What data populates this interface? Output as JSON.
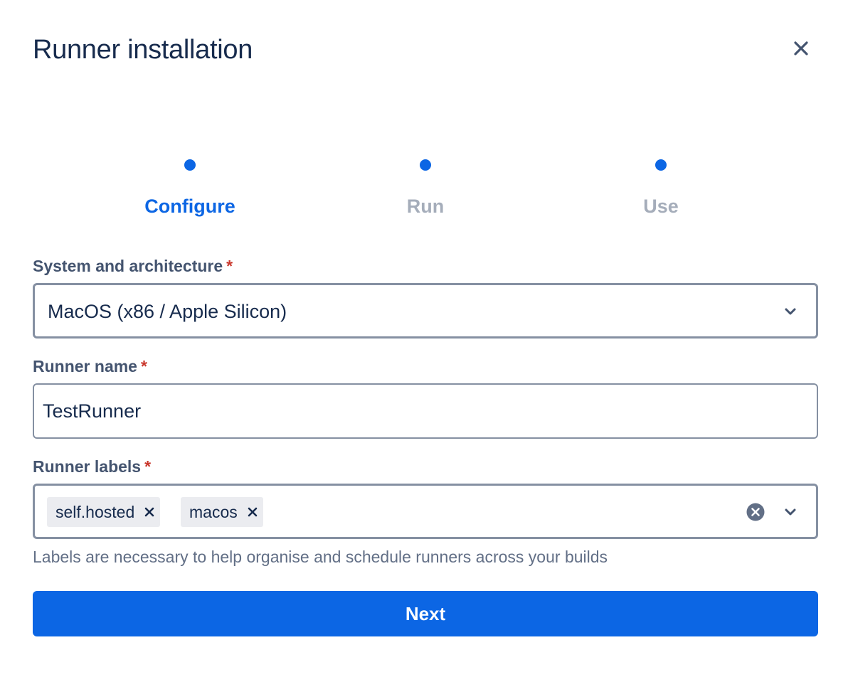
{
  "dialog": {
    "title": "Runner installation",
    "close_icon": "close-icon"
  },
  "stepper": {
    "active_color": "#0C66E4",
    "inactive_color": "#A5ADBA",
    "steps": [
      {
        "label": "Configure",
        "state": "active"
      },
      {
        "label": "Run",
        "state": "inactive"
      },
      {
        "label": "Use",
        "state": "inactive"
      }
    ]
  },
  "form": {
    "required_mark": "*",
    "system": {
      "label": "System and architecture",
      "selected": "MacOS (x86 / Apple Silicon)",
      "icon": "chevron-down-icon"
    },
    "runner_name": {
      "label": "Runner name",
      "value": "TestRunner"
    },
    "runner_labels": {
      "label": "Runner labels",
      "tags": [
        "self.hosted",
        "macos"
      ],
      "clear_icon": "clear-icon",
      "dropdown_icon": "chevron-down-icon",
      "helper": "Labels are necessary to help organise and schedule runners across your builds"
    }
  },
  "actions": {
    "next_label": "Next",
    "primary_color": "#0C66E4"
  }
}
